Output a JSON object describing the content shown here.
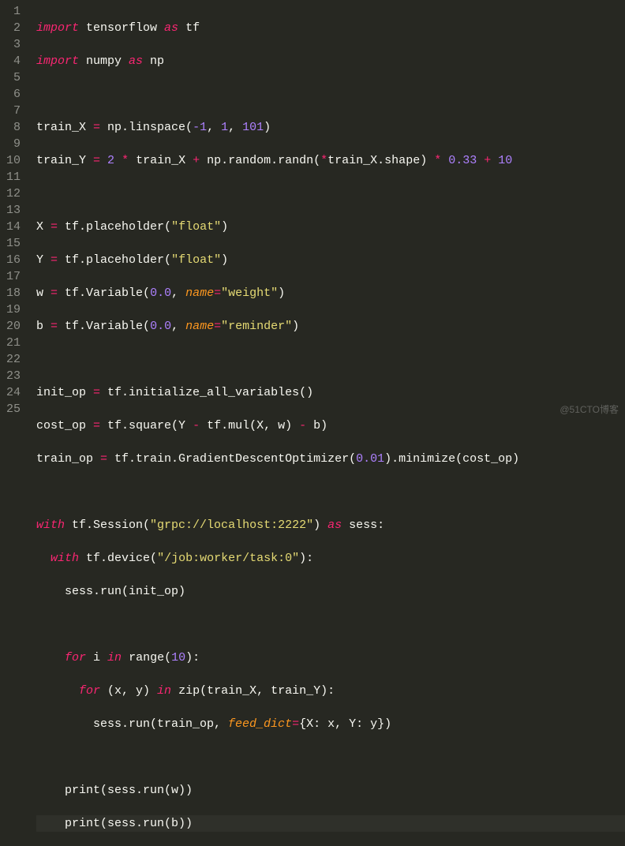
{
  "watermark": "@51CTO博客",
  "linenumbers": [
    "1",
    "2",
    "3",
    "4",
    "5",
    "6",
    "7",
    "8",
    "9",
    "10",
    "11",
    "12",
    "13",
    "14",
    "15",
    "16",
    "17",
    "18",
    "19",
    "20",
    "21",
    "22",
    "23",
    "24",
    "25"
  ],
  "highlighted_line": 25,
  "code": {
    "l1": {
      "t1": "import",
      "t2": " tensorflow ",
      "t3": "as",
      "t4": " tf"
    },
    "l2": {
      "t1": "import",
      "t2": " numpy ",
      "t3": "as",
      "t4": " np"
    },
    "l4": {
      "a": "train_X ",
      "eq": "=",
      "b": " np.linspace(",
      "n1": "-1",
      "c": ", ",
      "n2": "1",
      "d": ", ",
      "n3": "101",
      "e": ")"
    },
    "l5": {
      "a": "train_Y ",
      "eq": "=",
      "sp": " ",
      "n1": "2",
      "b": " ",
      "op1": "*",
      "c": " train_X ",
      "op2": "+",
      "d": " np.random.randn(",
      "op3": "*",
      "e": "train_X.shape) ",
      "op4": "*",
      "sp2": " ",
      "n2": "0.33",
      "sp3": " ",
      "op5": "+",
      "sp4": " ",
      "n3": "10"
    },
    "l7": {
      "a": "X ",
      "eq": "=",
      "b": " tf.placeholder(",
      "s": "\"float\"",
      "c": ")"
    },
    "l8": {
      "a": "Y ",
      "eq": "=",
      "b": " tf.placeholder(",
      "s": "\"float\"",
      "c": ")"
    },
    "l9": {
      "a": "w ",
      "eq": "=",
      "b": " tf.Variable(",
      "n": "0.0",
      "c": ", ",
      "arg": "name",
      "eq2": "=",
      "s": "\"weight\"",
      "d": ")"
    },
    "l10": {
      "a": "b ",
      "eq": "=",
      "b2": " tf.Variable(",
      "n": "0.0",
      "c": ", ",
      "arg": "name",
      "eq2": "=",
      "s": "\"reminder\"",
      "d": ")"
    },
    "l12": {
      "a": "init_op ",
      "eq": "=",
      "b": " tf.initialize_all_variables()"
    },
    "l13": {
      "a": "cost_op ",
      "eq": "=",
      "b": " tf.square(Y ",
      "op1": "-",
      "c": " tf.mul(X, w) ",
      "op2": "-",
      "d": " b)"
    },
    "l14": {
      "a": "train_op ",
      "eq": "=",
      "b": " tf.train.GradientDescentOptimizer(",
      "n": "0.01",
      "c": ").minimize(cost_op)"
    },
    "l16": {
      "kw1": "with",
      "a": " tf.Session(",
      "s": "\"grpc://localhost:2222\"",
      "b": ") ",
      "kw2": "as",
      "c": " sess:"
    },
    "l17": {
      "kw1": "with",
      "a": " tf.device(",
      "s": "\"/job:worker/task:0\"",
      "b": "):"
    },
    "l18": {
      "a": "sess.run(init_op)"
    },
    "l20": {
      "kw1": "for",
      "a": " i ",
      "kw2": "in",
      "b": " range(",
      "n": "10",
      "c": "):"
    },
    "l21": {
      "kw1": "for",
      "a": " (x, y) ",
      "kw2": "in",
      "b": " zip(train_X, train_Y):"
    },
    "l22": {
      "a": "sess.run(train_op, ",
      "arg": "feed_dict",
      "eq": "=",
      "b": "{X: x, Y: y})"
    },
    "l24": {
      "a": "print(sess.run(w))"
    },
    "l25": {
      "a": "print(sess.run(b))"
    }
  }
}
